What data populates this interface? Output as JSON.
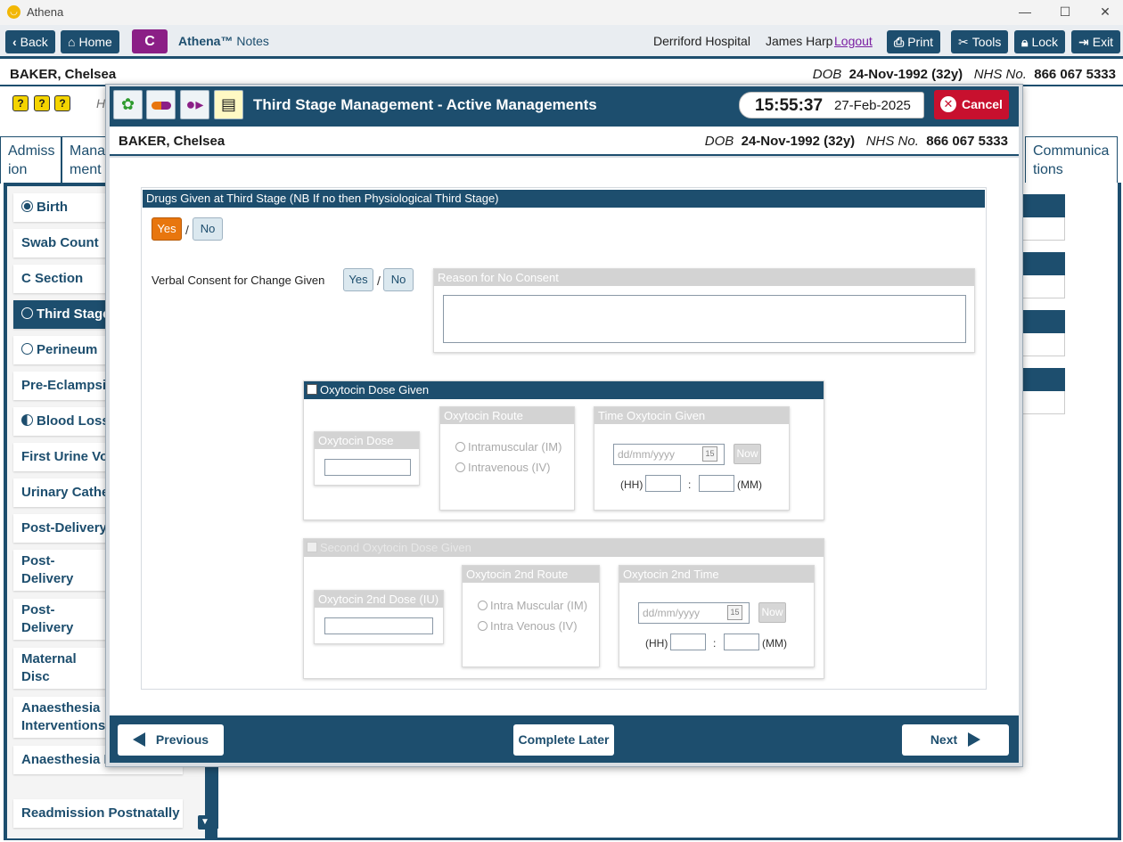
{
  "window": {
    "title": "Athena"
  },
  "toolbar": {
    "back": "Back",
    "home": "Home",
    "c": "C",
    "app_name": "Athena™",
    "app_suffix": "Notes",
    "hospital": "Derriford Hospital",
    "user": "James Harp",
    "logout": "Logout",
    "print": "Print",
    "tools": "Tools",
    "lock": "Lock",
    "exit": "Exit"
  },
  "patient": {
    "name": "BAKER, Chelsea",
    "dob_label": "DOB",
    "dob": "24-Nov-1992 (32y)",
    "nhs_label": "NHS No.",
    "nhs": "866 067 5333"
  },
  "subrow": {
    "partial_text": "H"
  },
  "tabs": [
    {
      "label": "Admiss ion"
    },
    {
      "label": "Mana ment"
    },
    {
      "label": "Communica tions"
    }
  ],
  "sidenav": {
    "items": [
      {
        "label": "Birth"
      },
      {
        "label": "Swab Count"
      },
      {
        "label": "C Section"
      },
      {
        "label": "Third Stage"
      },
      {
        "label": "Perineum"
      },
      {
        "label": "Pre-Eclampsia"
      },
      {
        "label": "Blood Loss"
      },
      {
        "label": "First Urine Voi"
      },
      {
        "label": "Urinary Cathe"
      },
      {
        "label": "Post-Delivery"
      },
      {
        "label": "Post-Delivery Notes"
      },
      {
        "label": "Post-Delivery Assessments"
      },
      {
        "label": "Maternal Disc Summary"
      },
      {
        "label": "Anaesthesia Interventions"
      },
      {
        "label": "Anaesthesia Fo"
      },
      {
        "label": "Readmission Postnatally"
      }
    ]
  },
  "modal": {
    "title": "Third Stage Management - Active Managements",
    "time": "15:55:37",
    "date": "27-Feb-2025",
    "cancel": "Cancel",
    "drugs_header": "Drugs Given at Third Stage (NB If no then Physiological Third Stage)",
    "yes": "Yes",
    "no": "No",
    "slash": "/",
    "verbal_consent_label": "Verbal Consent for Change Given",
    "reason_no_consent": "Reason for No Consent",
    "oxy_dose_given": "Oxytocin Dose Given",
    "oxy_dose_iu": "Oxytocin Dose (IU)",
    "oxy_route": "Oxytocin Route",
    "route_im": "Intramuscular (IM)",
    "route_iv": "Intravenous (IV)",
    "time_oxy_given": "Time Oxytocin Given",
    "date_placeholder": "dd/mm/yyyy",
    "now": "Now",
    "hh": "(HH)",
    "mm": "(MM)",
    "colon": ":",
    "cal_day": "15",
    "second_dose_given": "Second Oxytocin Dose Given",
    "oxy_2nd_dose": "Oxytocin 2nd Dose (IU)",
    "oxy_2nd_route": "Oxytocin 2nd Route",
    "route2_im": "Intra Muscular (IM)",
    "route2_iv": "Intra Venous (IV)",
    "oxy_2nd_time": "Oxytocin 2nd Time",
    "previous": "Previous",
    "complete_later": "Complete Later",
    "next": "Next"
  },
  "colors": {
    "primary": "#1d4e6e",
    "accent_orange": "#e8760e",
    "cancel_red": "#c8102e",
    "c_button": "#8b1f86"
  }
}
